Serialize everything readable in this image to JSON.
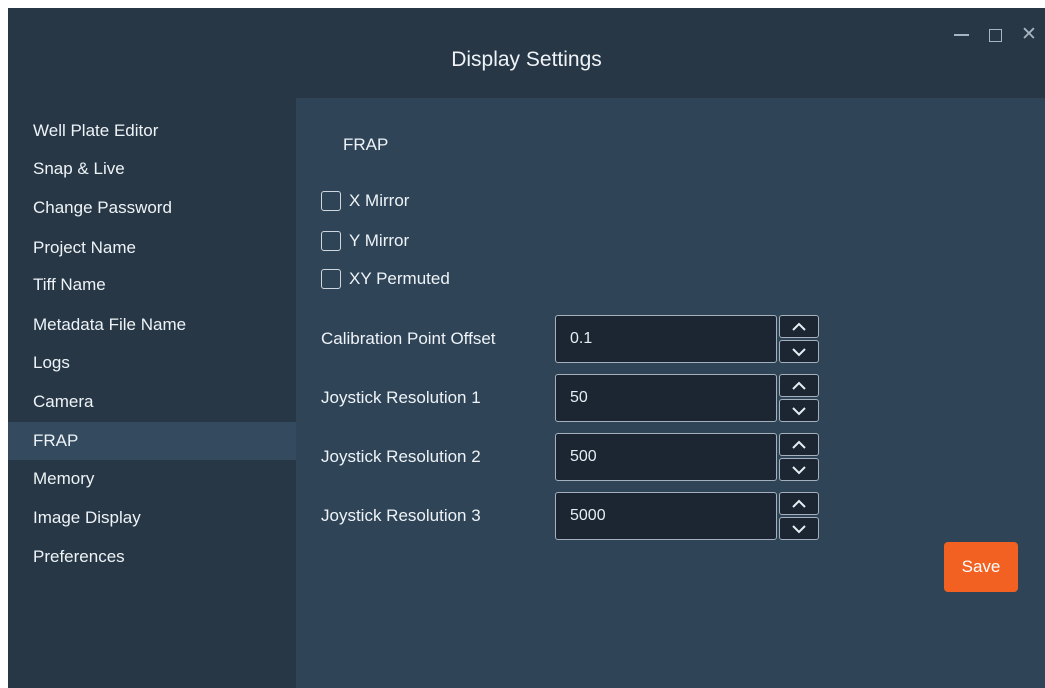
{
  "window": {
    "title": "Display Settings",
    "controls": [
      "minimize-icon",
      "maximize-icon",
      "close-icon"
    ],
    "close_glyph": "✕"
  },
  "sidebar": {
    "items": [
      {
        "label": "Well Plate Editor"
      },
      {
        "label": "Snap & Live"
      },
      {
        "label": "Change Password"
      },
      {
        "label": "Project Name"
      },
      {
        "label": "Tiff Name"
      },
      {
        "label": "Metadata File Name"
      },
      {
        "label": "Logs"
      },
      {
        "label": "Camera"
      },
      {
        "label": "FRAP",
        "selected": true
      },
      {
        "label": "Memory"
      },
      {
        "label": "Image Display"
      },
      {
        "label": "Preferences"
      }
    ]
  },
  "main": {
    "section_title": "FRAP",
    "checkboxes": [
      {
        "label": "X Mirror",
        "checked": false
      },
      {
        "label": "Y Mirror",
        "checked": false
      },
      {
        "label": "XY Permuted",
        "checked": false
      }
    ],
    "fields": [
      {
        "label": "Calibration Point Offset",
        "value": "0.1"
      },
      {
        "label": "Joystick Resolution 1",
        "value": "50"
      },
      {
        "label": "Joystick Resolution 2",
        "value": "500"
      },
      {
        "label": "Joystick Resolution 3",
        "value": "5000"
      }
    ],
    "save_label": "Save"
  },
  "colors": {
    "window_bg": "#2f4457",
    "sidebar_bg": "#273746",
    "selected_item_bg": "#344a5e",
    "input_bg": "#1b2632",
    "accent": "#f26122"
  },
  "icons": {
    "spin_up": "chevron-up-icon",
    "spin_down": "chevron-down-icon"
  }
}
